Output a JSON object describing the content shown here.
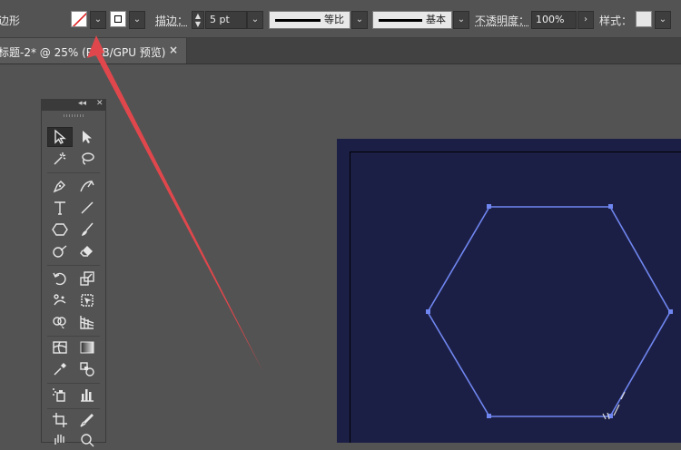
{
  "control_bar": {
    "left_label": "边形",
    "stroke_label": "描边：",
    "stroke_weight": "5 pt",
    "profile_label": "等比",
    "brush_label": "基本",
    "opacity_label": "不透明度：",
    "opacity_value": "100%",
    "style_label": "样式："
  },
  "tabs": {
    "document_title": "标题-2* @ 25% (RGB/GPU 预览)",
    "close_glyph": "×"
  },
  "tools_panel": {
    "collapse_glyph": "◂◂",
    "close_glyph": "✕",
    "tools": [
      {
        "name": "selection-tool",
        "icon": "arrow-outline-icon"
      },
      {
        "name": "direct-selection-tool",
        "icon": "arrow-filled-icon"
      },
      {
        "name": "magic-wand-tool",
        "icon": "wand-icon"
      },
      {
        "name": "lasso-tool",
        "icon": "lasso-icon"
      },
      {
        "name": "pen-tool",
        "icon": "pen-icon"
      },
      {
        "name": "curvature-tool",
        "icon": "curvature-icon"
      },
      {
        "name": "type-tool",
        "icon": "type-icon"
      },
      {
        "name": "line-segment-tool",
        "icon": "line-icon"
      },
      {
        "name": "polygon-tool",
        "icon": "hexagon-icon"
      },
      {
        "name": "paintbrush-tool",
        "icon": "brush-icon"
      },
      {
        "name": "shaper-tool",
        "icon": "shaper-icon"
      },
      {
        "name": "eraser-tool",
        "icon": "eraser-icon"
      },
      {
        "name": "rotate-tool",
        "icon": "rotate-icon"
      },
      {
        "name": "scale-tool",
        "icon": "scale-icon"
      },
      {
        "name": "puppet-warp-tool",
        "icon": "puppet-icon"
      },
      {
        "name": "free-transform-tool",
        "icon": "free-transform-icon"
      },
      {
        "name": "shape-builder-tool",
        "icon": "shape-builder-icon"
      },
      {
        "name": "perspective-grid-tool",
        "icon": "perspective-icon"
      },
      {
        "name": "mesh-tool",
        "icon": "mesh-icon"
      },
      {
        "name": "gradient-tool",
        "icon": "gradient-icon"
      },
      {
        "name": "eyedropper-tool",
        "icon": "eyedropper-icon"
      },
      {
        "name": "blend-tool",
        "icon": "blend-icon"
      },
      {
        "name": "symbol-sprayer-tool",
        "icon": "sprayer-icon"
      },
      {
        "name": "column-graph-tool",
        "icon": "graph-icon"
      },
      {
        "name": "artboard-tool",
        "icon": "artboard-icon"
      },
      {
        "name": "slice-tool",
        "icon": "slice-icon"
      },
      {
        "name": "hand-tool",
        "icon": "hand-icon"
      },
      {
        "name": "zoom-tool",
        "icon": "zoom-icon"
      }
    ]
  },
  "colors": {
    "ui_bg": "#535353",
    "artboard": "#1c1f45",
    "hexagon_stroke": "#6f86f0",
    "annotation_arrow": "#e0474c"
  }
}
